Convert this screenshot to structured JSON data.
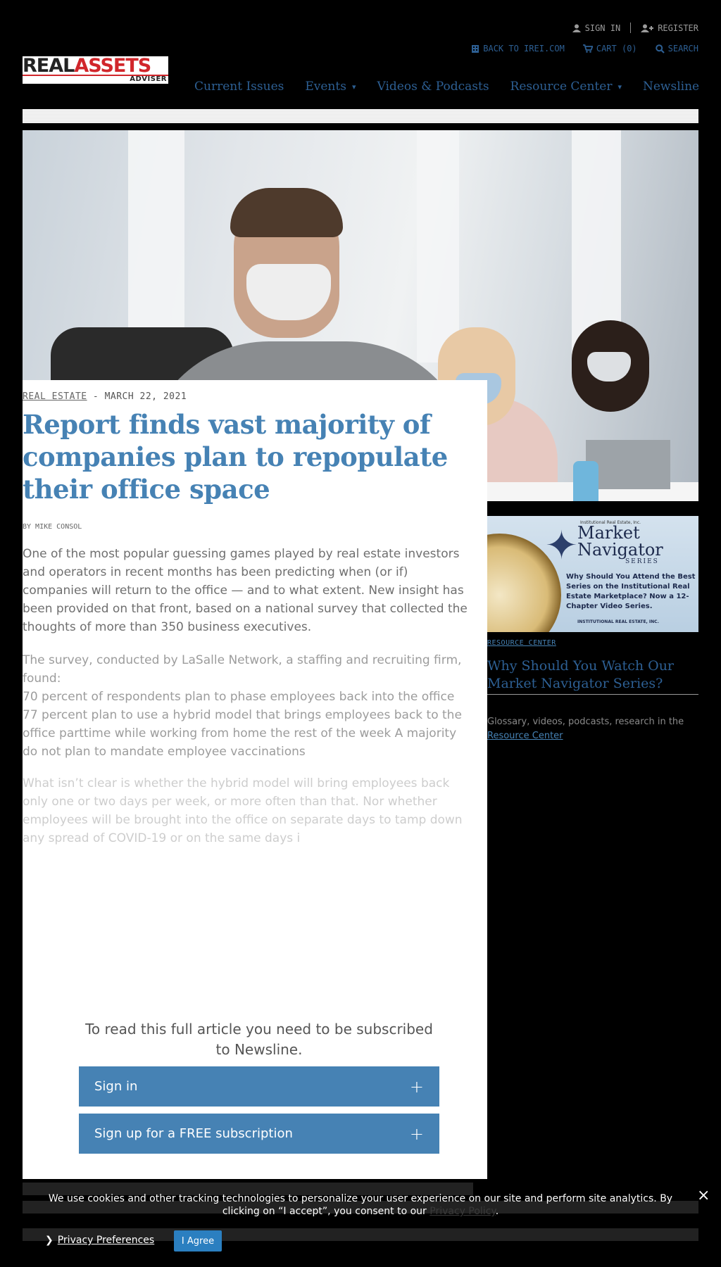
{
  "utility": {
    "sign_in": "SIGN IN",
    "register": "REGISTER",
    "back_link": "BACK TO IREI.COM",
    "cart": "CART (0)",
    "search": "SEARCH"
  },
  "logo": {
    "word1": "REAL",
    "word2": "ASSETS",
    "sub": "ADVISER"
  },
  "nav": [
    {
      "label": "Current Issues",
      "dropdown": false
    },
    {
      "label": "Events",
      "dropdown": true
    },
    {
      "label": "Videos & Podcasts",
      "dropdown": false
    },
    {
      "label": "Resource Center",
      "dropdown": true
    },
    {
      "label": "Newsline",
      "dropdown": false
    }
  ],
  "article": {
    "category": "REAL ESTATE",
    "date": " - MARCH 22, 2021",
    "title": "Report finds vast majority of companies plan to repopulate their office space",
    "byline": "BY MIKE CONSOL",
    "p1": "One of the most popular guessing games played by real estate investors and operators in recent months has been predicting when (or if) companies will return to the office — and to what extent. New insight has been provided on that front, based on a national survey that collected the thoughts of more than 350 business executives.",
    "p2a": "The survey, conducted by LaSalle Network, a staffing and recruiting firm, found:",
    "p2b": "70 percent of respondents plan to phase employees back into the office",
    "p2c": "77 percent plan to use a hybrid model that brings employees back to the office parttime while working from home the rest of the week A majority do not plan to mandate employee vaccinations",
    "p3": "What isn’t clear is whether the hybrid model will bring employees back only one or two days per week, or more often than that. Nor whether employees will be brought into the office on separate days to tamp down any spread of COVID-19 or on the same days i"
  },
  "paywall": {
    "message": "To read this full article you need to be subscribed to Newsline.",
    "sign_in": "Sign in",
    "sign_up": "Sign up for a FREE subscription",
    "plus": "+"
  },
  "ad": {
    "publisher": "Institutional Real Estate, Inc.",
    "title_line1": "Market",
    "title_line2": "Navigator",
    "series": "SERIES",
    "copy": "Why Should You Attend the Best Series on the Institutional Real Estate Marketplace? Now a 12-Chapter Video Series.",
    "footer": "INSTITUTIONAL REAL ESTATE, INC."
  },
  "sidebar": {
    "section": "RESOURCE CENTER",
    "heading": "Why Should You Watch Our Market Navigator Series?",
    "text": "Glossary, videos, podcasts, research in the ",
    "link": "Resource Center"
  },
  "cookie": {
    "text_before": "We use cookies and other tracking technologies to personalize your user experience on our site and perform site analytics. By clicking on “I accept”, you consent to our ",
    "policy_link": "Privacy Policy",
    "text_after": ".",
    "close": "×",
    "preferences": "Privacy Preferences",
    "agree": "I Agree"
  },
  "colors": {
    "accent": "#4682b4",
    "nav": "#2d5f93",
    "brand_red": "#d1262b",
    "background": "#000000"
  }
}
